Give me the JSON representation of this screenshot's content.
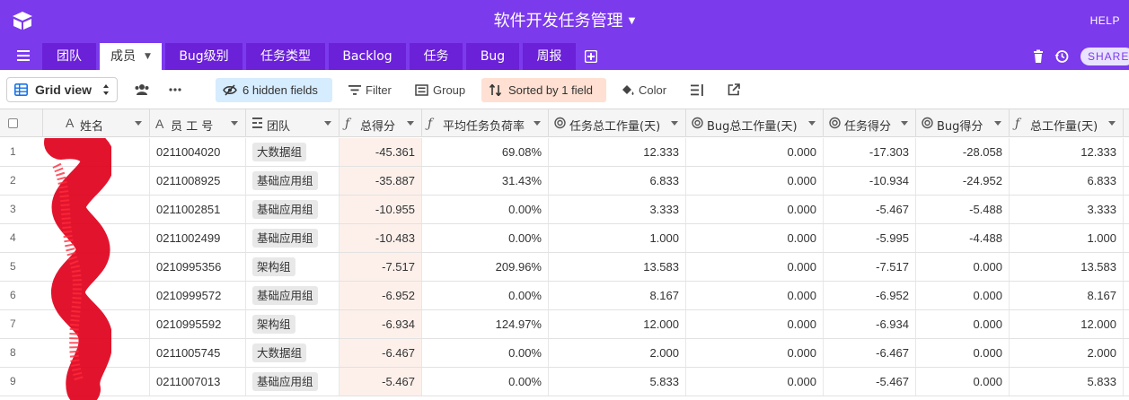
{
  "header": {
    "title": "软件开发任务管理",
    "help_label": "HELP",
    "share_label": "SHARE",
    "colors": {
      "primary": "#7c3aed",
      "tab_bg": "#6b21d8"
    }
  },
  "tabs": [
    {
      "label": "团队"
    },
    {
      "label": "成员",
      "active": true
    },
    {
      "label": "Bug级别"
    },
    {
      "label": "任务类型"
    },
    {
      "label": "Backlog"
    },
    {
      "label": "任务"
    },
    {
      "label": "Bug"
    },
    {
      "label": "周报"
    }
  ],
  "toolbar": {
    "view_label": "Grid view",
    "hidden_fields_label": "6 hidden fields",
    "filter_label": "Filter",
    "group_label": "Group",
    "sorted_label": "Sorted by 1 field",
    "color_label": "Color"
  },
  "columns": [
    {
      "label": "姓名",
      "icon": "text-field-icon"
    },
    {
      "label": "员 工 号",
      "icon": "text-field-icon"
    },
    {
      "label": "团队",
      "icon": "link-field-icon"
    },
    {
      "label": "总得分",
      "icon": "formula-icon"
    },
    {
      "label": "平均任务负荷率",
      "icon": "formula-icon"
    },
    {
      "label": "任务总工作量(天)",
      "icon": "rollup-icon"
    },
    {
      "label": "Bug总工作量(天)",
      "icon": "rollup-icon"
    },
    {
      "label": "任务得分",
      "icon": "rollup-icon"
    },
    {
      "label": "Bug得分",
      "icon": "rollup-icon"
    },
    {
      "label": "总工作量(天)",
      "icon": "formula-icon"
    }
  ],
  "rows": [
    {
      "idx": "1",
      "id": "0211004020",
      "team": "大数据组",
      "score": "-45.361",
      "load": "69.08%",
      "task_work": "12.333",
      "bug_work": "0.000",
      "task_score": "-17.303",
      "bug_score": "-28.058",
      "total_work": "12.333"
    },
    {
      "idx": "2",
      "id": "0211008925",
      "team": "基础应用组",
      "score": "-35.887",
      "load": "31.43%",
      "task_work": "6.833",
      "bug_work": "0.000",
      "task_score": "-10.934",
      "bug_score": "-24.952",
      "total_work": "6.833"
    },
    {
      "idx": "3",
      "id": "0211002851",
      "team": "基础应用组",
      "score": "-10.955",
      "load": "0.00%",
      "task_work": "3.333",
      "bug_work": "0.000",
      "task_score": "-5.467",
      "bug_score": "-5.488",
      "total_work": "3.333"
    },
    {
      "idx": "4",
      "id": "0211002499",
      "team": "基础应用组",
      "score": "-10.483",
      "load": "0.00%",
      "task_work": "1.000",
      "bug_work": "0.000",
      "task_score": "-5.995",
      "bug_score": "-4.488",
      "total_work": "1.000"
    },
    {
      "idx": "5",
      "id": "0210995356",
      "team": "架构组",
      "score": "-7.517",
      "load": "209.96%",
      "task_work": "13.583",
      "bug_work": "0.000",
      "task_score": "-7.517",
      "bug_score": "0.000",
      "total_work": "13.583"
    },
    {
      "idx": "6",
      "id": "0210999572",
      "team": "基础应用组",
      "score": "-6.952",
      "load": "0.00%",
      "task_work": "8.167",
      "bug_work": "0.000",
      "task_score": "-6.952",
      "bug_score": "0.000",
      "total_work": "8.167"
    },
    {
      "idx": "7",
      "id": "0210995592",
      "team": "架构组",
      "score": "-6.934",
      "load": "124.97%",
      "task_work": "12.000",
      "bug_work": "0.000",
      "task_score": "-6.934",
      "bug_score": "0.000",
      "total_work": "12.000"
    },
    {
      "idx": "8",
      "id": "0211005745",
      "team": "大数据组",
      "score": "-6.467",
      "load": "0.00%",
      "task_work": "2.000",
      "bug_work": "0.000",
      "task_score": "-6.467",
      "bug_score": "0.000",
      "total_work": "2.000"
    },
    {
      "idx": "9",
      "id": "0211007013",
      "team": "基础应用组",
      "score": "-5.467",
      "load": "0.00%",
      "task_work": "5.833",
      "bug_work": "0.000",
      "task_score": "-5.467",
      "bug_score": "0.000",
      "total_work": "5.833"
    }
  ]
}
